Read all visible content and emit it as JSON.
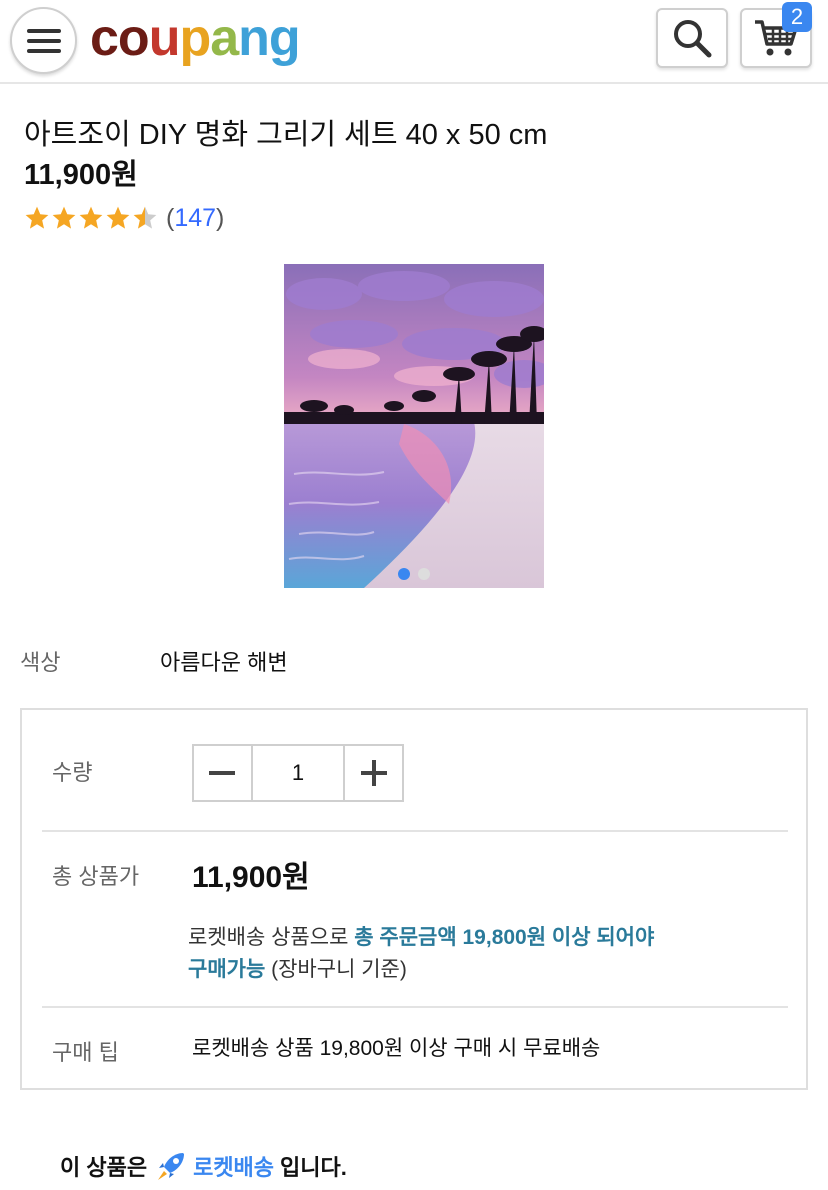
{
  "header": {
    "logo_letters": [
      {
        "char": "c",
        "color": "#6b1c15"
      },
      {
        "char": "o",
        "color": "#6b1c15"
      },
      {
        "char": "u",
        "color": "#c3382d"
      },
      {
        "char": "p",
        "color": "#e8a320"
      },
      {
        "char": "a",
        "color": "#94b84a"
      },
      {
        "char": "n",
        "color": "#3ea1d8"
      },
      {
        "char": "g",
        "color": "#3ea1d8"
      }
    ],
    "menu_icon": "hamburger-icon",
    "search_icon": "search-icon",
    "cart_icon": "cart-icon",
    "cart_count": "2"
  },
  "product": {
    "title": "아트조이 DIY 명화 그리기 세트 40 x 50 cm",
    "price": "11,900원",
    "rating_stars": 4.5,
    "review_count_open": "(",
    "review_count": "147",
    "review_count_close": ")",
    "image_dots": 2,
    "active_dot": 0
  },
  "option": {
    "label": "색상",
    "value": "아름다운 해변"
  },
  "purchase": {
    "quantity_label": "수량",
    "quantity_value": "1",
    "total_label": "총 상품가",
    "total_price": "11,900원",
    "notice_prefix": "로켓배송 상품으로 ",
    "notice_highlight_1": "총 주문금액 19,800원 이상 되어야",
    "notice_highlight_2": "구매가능",
    "notice_suffix": " (장바구니 기준)",
    "tip_label": "구매 팁",
    "tip_text": "로켓배송 상품 19,800원 이상 구매 시 무료배송"
  },
  "rocket": {
    "prefix": "이 상품은",
    "badge": "로켓배송",
    "suffix": "입니다.",
    "icon": "rocket-icon"
  },
  "colors": {
    "accent_blue": "#3a87f0",
    "star": "#f5a623",
    "notice_highlight": "#2a7a9a"
  }
}
